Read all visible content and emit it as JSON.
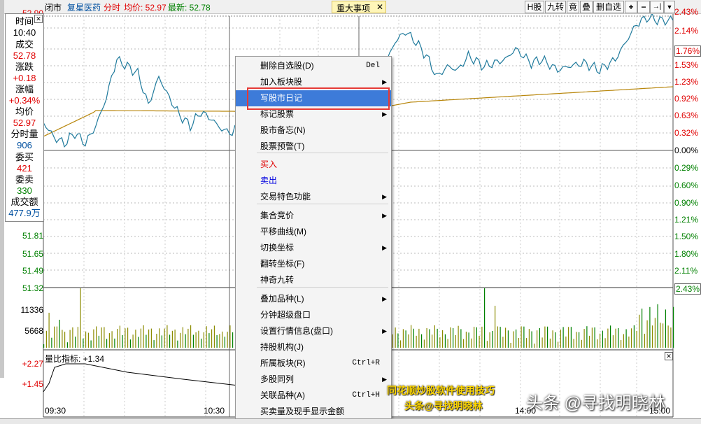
{
  "topbar": {
    "status": "闭市",
    "stock_name": "复星医药",
    "mode": "分时",
    "avg_label": "均价: 52.97",
    "latest_label": "最新: 52.78",
    "news_tab": "重大事项",
    "news_close": "✕",
    "btn_h": "H股",
    "btn_jiuzhuan": "九转",
    "btn_jing": "竟",
    "btn_die": "叠",
    "btn_delete": "删自选",
    "btn_plus": "+",
    "btn_minus": "−",
    "btn_end": "→|",
    "btn_menu": "▼"
  },
  "info": {
    "time_label": "时间",
    "time_value": "10:40",
    "price_label": "成交",
    "price_value": "52.78",
    "change_label": "涨跌",
    "change_value": "+0.18",
    "pct_label": "涨幅",
    "pct_value": "+0.34%",
    "avg_label": "均价",
    "avg_value": "52.97",
    "vol_label": "分时量",
    "vol_value": "906",
    "bid_label": "委买",
    "bid_value": "421",
    "ask_label": "委卖",
    "ask_value": "330",
    "amount_label": "成交额",
    "amount_value": "477.9万"
  },
  "axis": {
    "left_top": "52.90",
    "left_prices": [
      "51.81",
      "51.65",
      "51.49",
      "51.32"
    ],
    "left_vol": [
      "11336",
      "5668"
    ],
    "left_ratio": [
      "+2.27",
      "+1.45"
    ],
    "right_pct": [
      "2.43%",
      "2.14%",
      "1.76%",
      "1.53%",
      "1.23%",
      "0.92%",
      "0.63%",
      "0.32%",
      "0.00%",
      "0.29%",
      "0.60%",
      "0.90%",
      "1.21%",
      "1.50%",
      "1.80%",
      "2.11%",
      "2.43%"
    ],
    "times": [
      "09:30",
      "10:30",
      "14:00",
      "15:00"
    ]
  },
  "indicator": {
    "label": "量比指标: +1.34",
    "close": "✕"
  },
  "menu": {
    "items": [
      {
        "label": "删除自选股(D)",
        "shortcut": "Del"
      },
      {
        "label": "加入板块股",
        "arrow": "▶"
      },
      {
        "label": "写股市日记",
        "highlighted": true
      },
      {
        "label": "标记股票",
        "arrow": "▶"
      },
      {
        "label": "股市备忘(N)"
      },
      {
        "label": "股票预警(T)"
      },
      {
        "label": "买入",
        "color": "#e00000"
      },
      {
        "label": "卖出",
        "color": "#0000e0"
      },
      {
        "label": "交易特色功能",
        "arrow": "▶"
      },
      {
        "label": "集合竞价",
        "arrow": "▶"
      },
      {
        "label": "平移曲线(M)"
      },
      {
        "label": "切换坐标",
        "arrow": "▶"
      },
      {
        "label": "翻转坐标(F)"
      },
      {
        "label": "神奇九转"
      },
      {
        "label": "叠加品种(L)",
        "arrow": "▶"
      },
      {
        "label": "分钟超级盘口"
      },
      {
        "label": "设置行情信息(盘口)",
        "arrow": "▶"
      },
      {
        "label": "持股机构(J)"
      },
      {
        "label": "所属板块(R)",
        "shortcut": "Ctrl+R"
      },
      {
        "label": "多股同列",
        "arrow": "▶"
      },
      {
        "label": "关联品种(A)",
        "shortcut": "Ctrl+H"
      },
      {
        "label": "买卖量及现手显示金额"
      }
    ]
  },
  "watermark": {
    "line1": "同花顺炒股软件使用技巧",
    "line2": "头条@寻找明晓林",
    "brand": "头条 @寻找明晓林"
  },
  "colors": {
    "price_line": "#1f7a9c",
    "avg_line": "#b8860b",
    "volume_bar": "#8b8b00",
    "highlight_border": "#e53935",
    "up": "#e00000",
    "down": "#008000"
  }
}
